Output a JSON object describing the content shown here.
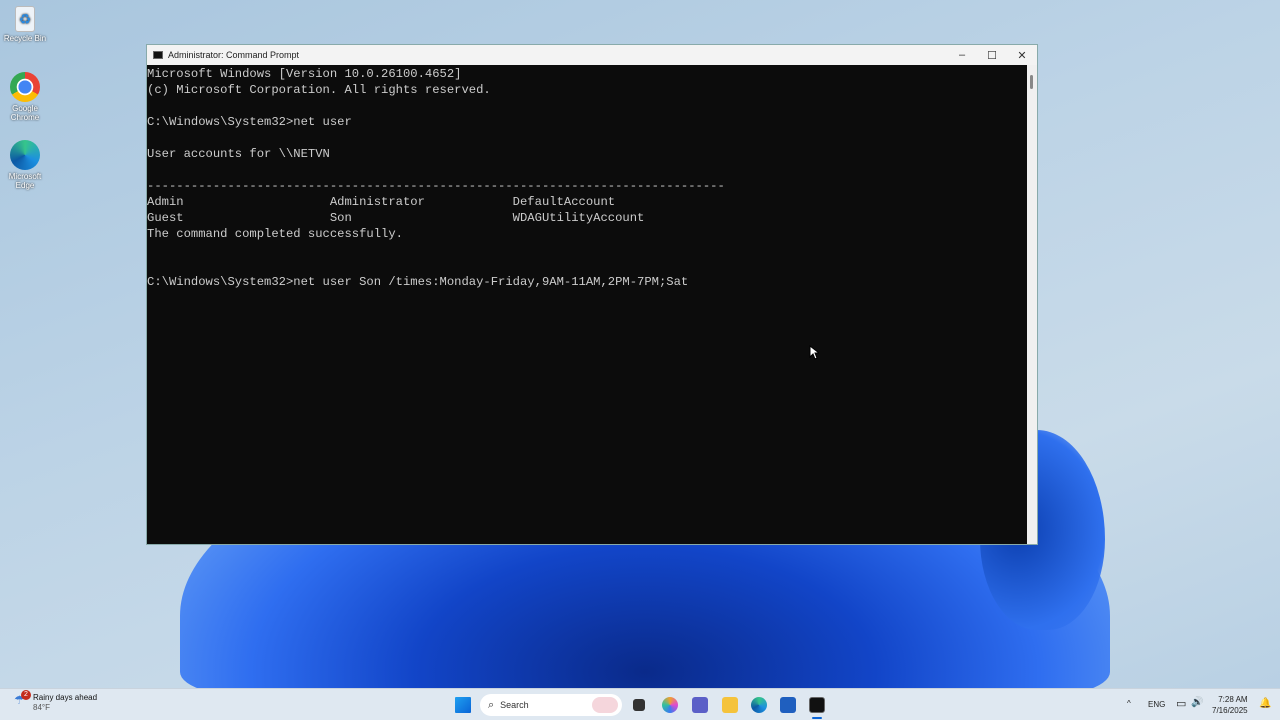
{
  "desktop": {
    "icons": [
      {
        "label": "Recycle Bin"
      },
      {
        "label": "Google Chrome"
      },
      {
        "label": "Microsoft Edge"
      }
    ]
  },
  "window": {
    "title": "Administrator: Command Prompt",
    "controls": {
      "minimize": "–",
      "maximize": "☐",
      "close": "✕"
    }
  },
  "terminal": {
    "lines": [
      "Microsoft Windows [Version 10.0.26100.4652]",
      "(c) Microsoft Corporation. All rights reserved.",
      "",
      "C:\\Windows\\System32>net user",
      "",
      "User accounts for \\\\NETVN",
      "",
      "-------------------------------------------------------------------------------",
      "Admin                    Administrator            DefaultAccount",
      "Guest                    Son                      WDAGUtilityAccount",
      "The command completed successfully.",
      "",
      "",
      "C:\\Windows\\System32>net user Son /times:Monday-Friday,9AM-11AM,2PM-7PM;Sat"
    ]
  },
  "taskbar": {
    "weather": {
      "badge": "2",
      "title": "Rainy days ahead",
      "temp": "84°F"
    },
    "search_placeholder": "Search",
    "tray": {
      "chevron": "^",
      "lang": "ENG",
      "time": "7:28 AM",
      "date": "7/16/2025"
    }
  }
}
